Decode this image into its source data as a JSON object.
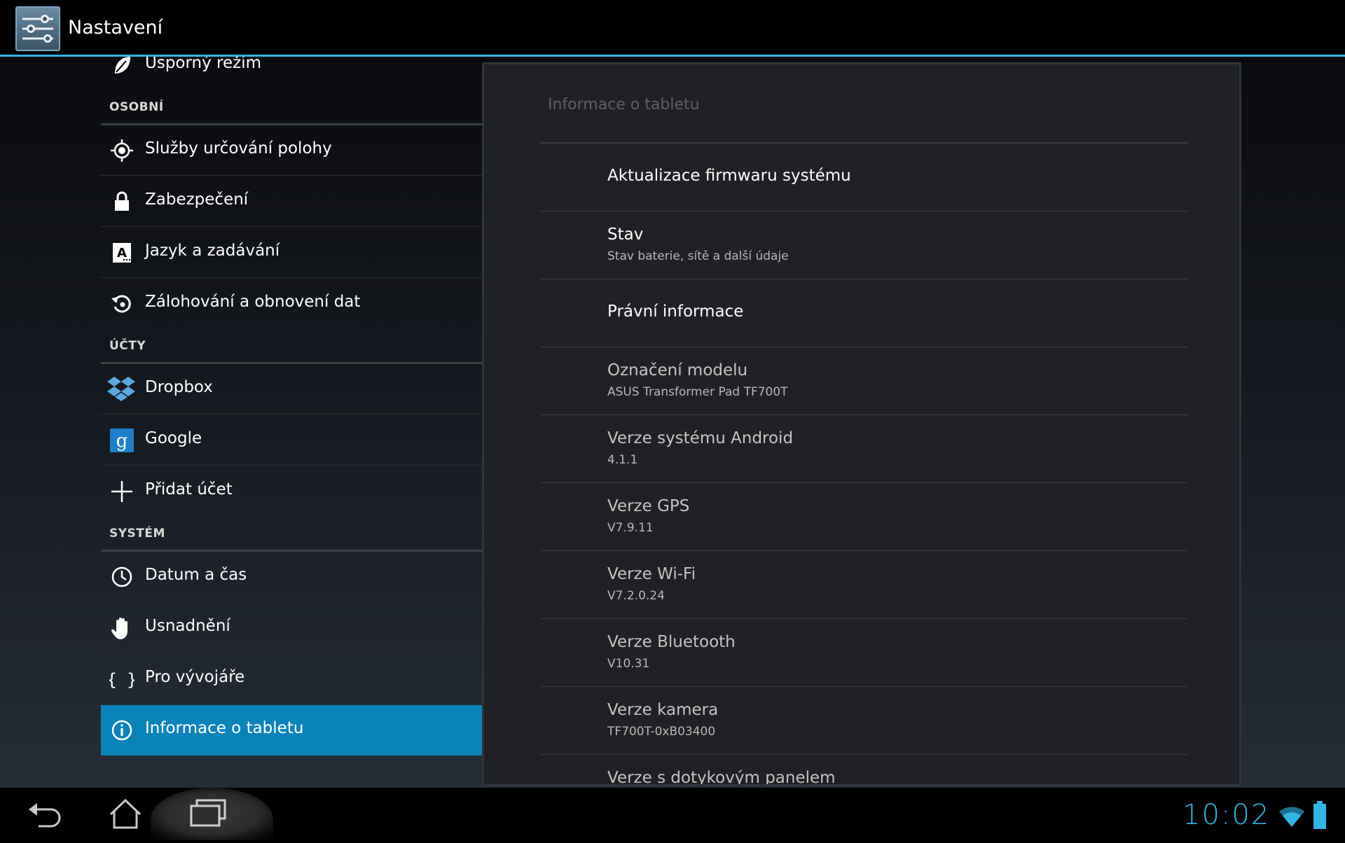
{
  "actionbar": {
    "title": "Nastavení",
    "icon": "settings-sliders-icon"
  },
  "left_list": {
    "items": [
      {
        "label": "Úsporný režim",
        "icon": "leaf-icon"
      },
      {
        "label": "Služby určování polohy",
        "icon": "location-icon"
      },
      {
        "label": "Zabezpečení",
        "icon": "lock-icon"
      },
      {
        "label": "Jazyk a zadávání",
        "icon": "language-icon"
      },
      {
        "label": "Zálohování a obnovení dat",
        "icon": "backup-icon"
      },
      {
        "label": "Dropbox",
        "icon": "dropbox-icon"
      },
      {
        "label": "Google",
        "icon": "google-icon"
      },
      {
        "label": "Přidat účet",
        "icon": "plus-icon"
      },
      {
        "label": "Datum a čas",
        "icon": "clock-icon"
      },
      {
        "label": "Usnadnění",
        "icon": "hand-icon"
      },
      {
        "label": "Pro vývojáře",
        "icon": "braces-icon"
      },
      {
        "label": "Informace o tabletu",
        "icon": "info-icon"
      }
    ],
    "headers": [
      "OSOBNÍ",
      "ÚČTY",
      "SYSTÉM"
    ],
    "selected_label": "Informace o tabletu"
  },
  "detail": {
    "title": "Informace o tabletu",
    "rows": [
      {
        "title": "Aktualizace firmwaru systému",
        "summary": ""
      },
      {
        "title": "Stav",
        "summary": "Stav baterie, sítě a další údaje"
      },
      {
        "title": "Právní informace",
        "summary": ""
      },
      {
        "title": "Označení modelu",
        "summary": "ASUS Transformer Pad TF700T"
      },
      {
        "title": "Verze systému Android",
        "summary": "4.1.1"
      },
      {
        "title": "Verze GPS",
        "summary": "V7.9.11"
      },
      {
        "title": "Verze Wi-Fi",
        "summary": "V7.2.0.24"
      },
      {
        "title": "Verze Bluetooth",
        "summary": "V10.31"
      },
      {
        "title": "Verze kamera",
        "summary": "TF700T-0xB03400"
      },
      {
        "title": "Verze s dotykovým panelem",
        "summary": ""
      }
    ]
  },
  "navbar": {
    "back": "back-icon",
    "home": "home-icon",
    "recents": "recent-apps-icon",
    "clock": "10:02",
    "wifi": "wifi-icon",
    "battery": "battery-icon"
  },
  "colors": {
    "accent": "#33b5e5",
    "selected": "#0a83b8"
  }
}
